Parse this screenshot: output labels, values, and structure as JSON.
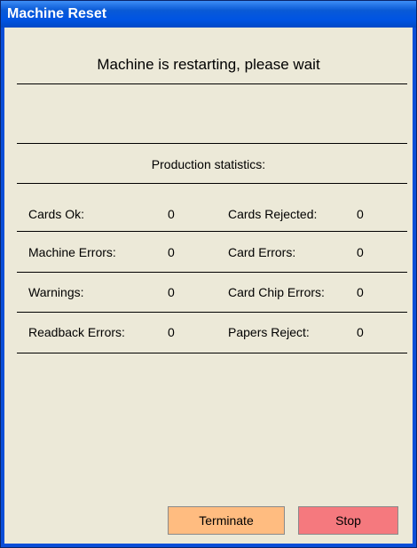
{
  "window": {
    "title": "Machine Reset"
  },
  "status_message": "Machine is restarting, please wait",
  "stats": {
    "title": "Production statistics:",
    "rows": [
      {
        "left_label": "Cards Ok:",
        "left_value": "0",
        "right_label": "Cards Rejected:",
        "right_value": "0"
      },
      {
        "left_label": "Machine Errors:",
        "left_value": "0",
        "right_label": "Card Errors:",
        "right_value": "0"
      },
      {
        "left_label": "Warnings:",
        "left_value": "0",
        "right_label": "Card Chip Errors:",
        "right_value": "0"
      },
      {
        "left_label": "Readback Errors:",
        "left_value": "0",
        "right_label": "Papers Reject:",
        "right_value": "0"
      }
    ]
  },
  "buttons": {
    "terminate_label": "Terminate",
    "stop_label": "Stop"
  },
  "colors": {
    "titlebar": "#0054e3",
    "background": "#ece9d8",
    "terminate": "#ffbc80",
    "stop": "#f5797e"
  }
}
